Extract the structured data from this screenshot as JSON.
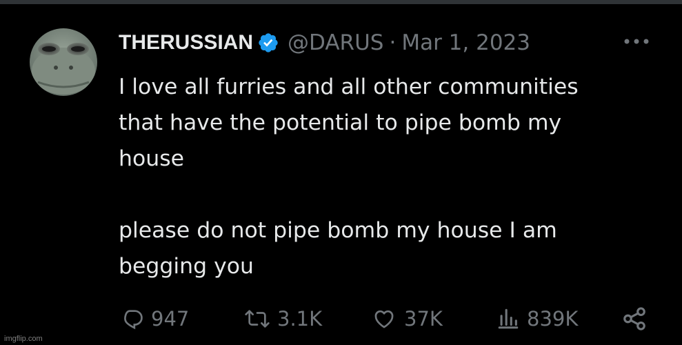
{
  "tweet": {
    "author_name": "THERUSSIAN",
    "handle": "@DARUS",
    "separator": "·",
    "date": "Mar 1, 2023",
    "paragraph_1": [
      "I love all furries and all other communities",
      "that have the potential to pipe bomb my",
      "house"
    ],
    "paragraph_2": [
      "please do not pipe bomb my house I am",
      "begging you"
    ]
  },
  "metrics": {
    "replies": "947",
    "reposts": "3.1K",
    "likes": "37K",
    "views": "839K"
  },
  "colors": {
    "background": "#000000",
    "text": "#e7e9ea",
    "muted": "#71767b",
    "verified": "#1d9bf0"
  },
  "icons": [
    "avatar",
    "verified-badge-icon",
    "more-options-icon",
    "reply-icon",
    "repost-icon",
    "like-icon",
    "views-icon",
    "share-icon"
  ],
  "watermark": "imgflip.com"
}
